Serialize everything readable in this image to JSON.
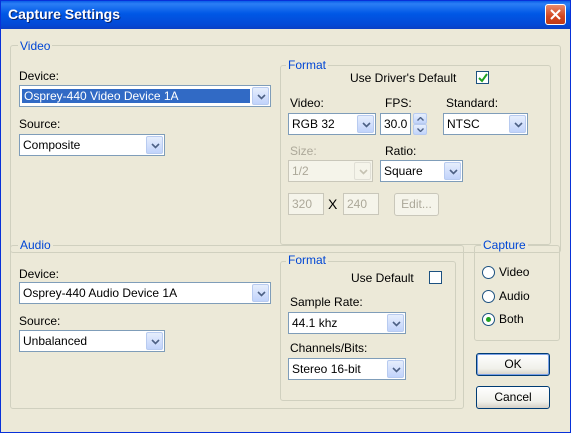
{
  "window": {
    "title": "Capture Settings"
  },
  "video": {
    "group_label": "Video",
    "device_label": "Device:",
    "device_value": "Osprey-440 Video Device 1A",
    "source_label": "Source:",
    "source_value": "Composite",
    "format": {
      "group_label": "Format",
      "use_driver_default_label": "Use Driver's Default",
      "use_driver_default_checked": true,
      "video_label": "Video:",
      "video_value": "RGB 32",
      "fps_label": "FPS:",
      "fps_value": "30.0",
      "standard_label": "Standard:",
      "standard_value": "NTSC",
      "size_label": "Size:",
      "size_value": "1/2",
      "ratio_label": "Ratio:",
      "ratio_value": "Square",
      "width_value": "320",
      "times_sign": "X",
      "height_value": "240",
      "edit_label": "Edit..."
    }
  },
  "audio": {
    "group_label": "Audio",
    "device_label": "Device:",
    "device_value": "Osprey-440 Audio Device 1A",
    "source_label": "Source:",
    "source_value": "Unbalanced",
    "format": {
      "group_label": "Format",
      "use_default_label": "Use Default",
      "use_default_checked": false,
      "sample_rate_label": "Sample Rate:",
      "sample_rate_value": "44.1 khz",
      "channels_label": "Channels/Bits:",
      "channels_value": "Stereo 16-bit"
    }
  },
  "capture": {
    "group_label": "Capture",
    "options": [
      {
        "label": "Video",
        "selected": false
      },
      {
        "label": "Audio",
        "selected": false
      },
      {
        "label": "Both",
        "selected": true
      }
    ]
  },
  "buttons": {
    "ok": "OK",
    "cancel": "Cancel"
  },
  "colors": {
    "title_bar": "#0058e6",
    "dialog_bg": "#ece9d8",
    "group_label": "#0046d5",
    "selection": "#316ac5",
    "close_button": "#d2461f"
  }
}
